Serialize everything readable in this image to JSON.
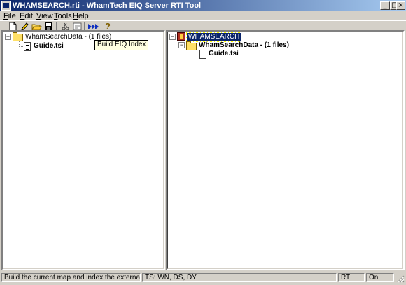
{
  "window": {
    "title": "WHAMSEARCH.rti - WhamTech EIQ Server RTI Tool",
    "controls": {
      "minimize": "_",
      "maximize": "□",
      "close": "×"
    }
  },
  "menu": [
    {
      "key": "F",
      "rest": "ile"
    },
    {
      "key": "E",
      "rest": "dit"
    },
    {
      "key": "V",
      "rest": "iew"
    },
    {
      "key": "T",
      "rest": "ools"
    },
    {
      "key": "H",
      "rest": "elp"
    }
  ],
  "toolbar": {
    "icons": [
      "new-file-icon",
      "pencil-icon",
      "open-folder-icon",
      "save-disk-icon",
      "scissors-icon",
      "properties-icon",
      "build-index-icon",
      "help-icon"
    ],
    "help_glyph": "?"
  },
  "tooltip": {
    "text": "Build EIQ Index"
  },
  "left_tree": {
    "root": {
      "label": "WhamSearchData - (1 files)",
      "expander": "−"
    },
    "child": {
      "label": "Guide.tsi"
    }
  },
  "right_tree": {
    "root": {
      "label": "WHAMSEARCH",
      "expander": "−"
    },
    "folder": {
      "label": "WhamSearchData - (1 files)",
      "expander": "−"
    },
    "child": {
      "label": "Guide.tsi"
    }
  },
  "status": {
    "message": "Build the current map and index the external data",
    "ts": "TS: WN, DS, DY",
    "mode": "RTI",
    "state": "On"
  },
  "colors": {
    "title_start": "#0a246a",
    "title_end": "#a6caf0",
    "chrome": "#d4d0c8",
    "selection": "#0a246a",
    "tooltip_bg": "#ffffe1"
  }
}
